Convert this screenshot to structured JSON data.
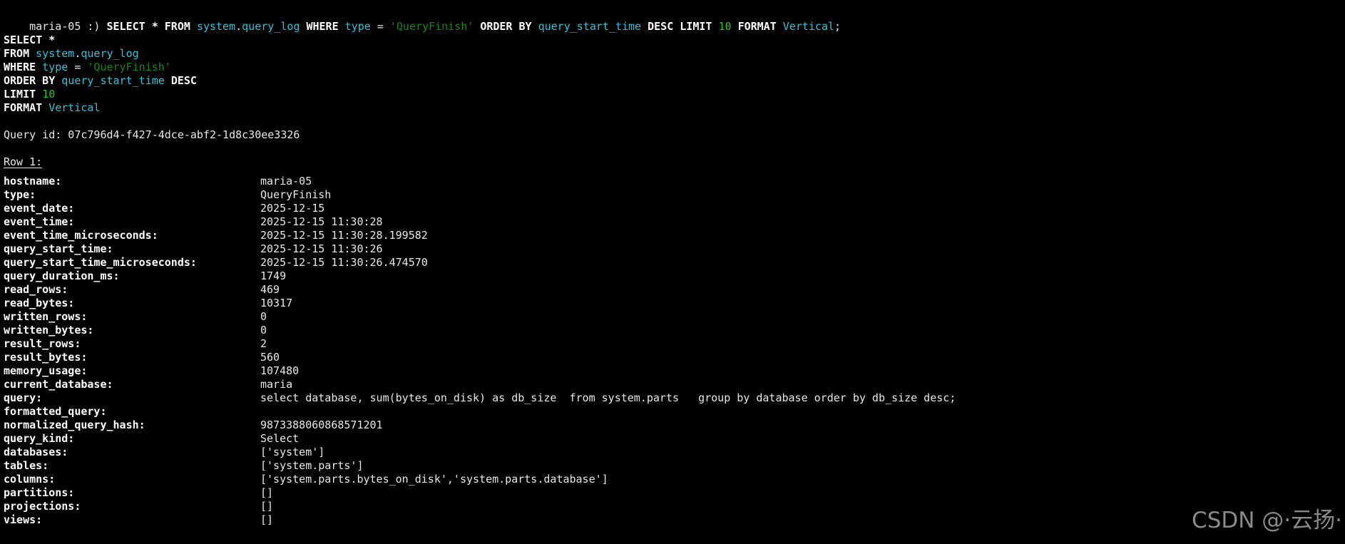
{
  "prompt": {
    "host": "maria-05",
    "symbol": ":)"
  },
  "command_tokens": [
    {
      "t": "SELECT",
      "c": "kw"
    },
    {
      "t": " * ",
      "c": "kw"
    },
    {
      "t": "FROM",
      "c": "kw"
    },
    {
      "t": " ",
      "c": "plain"
    },
    {
      "t": "system",
      "c": "id"
    },
    {
      "t": ".",
      "c": "plain"
    },
    {
      "t": "query_log",
      "c": "id"
    },
    {
      "t": " ",
      "c": "plain"
    },
    {
      "t": "WHERE",
      "c": "kw"
    },
    {
      "t": " ",
      "c": "plain"
    },
    {
      "t": "type",
      "c": "id"
    },
    {
      "t": " = ",
      "c": "plain"
    },
    {
      "t": "'QueryFinish'",
      "c": "str"
    },
    {
      "t": " ",
      "c": "plain"
    },
    {
      "t": "ORDER BY",
      "c": "kw"
    },
    {
      "t": " ",
      "c": "plain"
    },
    {
      "t": "query_start_time",
      "c": "id"
    },
    {
      "t": " ",
      "c": "plain"
    },
    {
      "t": "DESC",
      "c": "kw"
    },
    {
      "t": " ",
      "c": "plain"
    },
    {
      "t": "LIMIT",
      "c": "kw"
    },
    {
      "t": " ",
      "c": "plain"
    },
    {
      "t": "10",
      "c": "num"
    },
    {
      "t": " ",
      "c": "plain"
    },
    {
      "t": "FORMAT",
      "c": "kw"
    },
    {
      "t": " ",
      "c": "plain"
    },
    {
      "t": "Vertical",
      "c": "id"
    },
    {
      "t": ";",
      "c": "plain"
    }
  ],
  "formatted_lines": [
    [
      {
        "t": "SELECT *",
        "c": "kw"
      }
    ],
    [
      {
        "t": "FROM",
        "c": "kw"
      },
      {
        "t": " ",
        "c": "plain"
      },
      {
        "t": "system",
        "c": "id"
      },
      {
        "t": ".",
        "c": "plain"
      },
      {
        "t": "query_log",
        "c": "id"
      }
    ],
    [
      {
        "t": "WHERE",
        "c": "kw"
      },
      {
        "t": " ",
        "c": "plain"
      },
      {
        "t": "type",
        "c": "id"
      },
      {
        "t": " = ",
        "c": "plain"
      },
      {
        "t": "'QueryFinish'",
        "c": "str"
      }
    ],
    [
      {
        "t": "ORDER BY",
        "c": "kw"
      },
      {
        "t": " ",
        "c": "plain"
      },
      {
        "t": "query_start_time",
        "c": "id"
      },
      {
        "t": " ",
        "c": "plain"
      },
      {
        "t": "DESC",
        "c": "kw"
      }
    ],
    [
      {
        "t": "LIMIT",
        "c": "kw"
      },
      {
        "t": " ",
        "c": "plain"
      },
      {
        "t": "10",
        "c": "num"
      }
    ],
    [
      {
        "t": "FORMAT",
        "c": "kw"
      },
      {
        "t": " ",
        "c": "plain"
      },
      {
        "t": "Vertical",
        "c": "id"
      }
    ]
  ],
  "query_id_line": "Query id: 07c796d4-f427-4dce-abf2-1d8c30ee3326",
  "row_header": "Row 1:",
  "fields": [
    {
      "name": "hostname:",
      "value": "maria-05"
    },
    {
      "name": "type:",
      "value": "QueryFinish"
    },
    {
      "name": "event_date:",
      "value": "2025-12-15"
    },
    {
      "name": "event_time:",
      "value": "2025-12-15 11:30:28"
    },
    {
      "name": "event_time_microseconds:",
      "value": "2025-12-15 11:30:28.199582"
    },
    {
      "name": "query_start_time:",
      "value": "2025-12-15 11:30:26"
    },
    {
      "name": "query_start_time_microseconds:",
      "value": "2025-12-15 11:30:26.474570"
    },
    {
      "name": "query_duration_ms:",
      "value": "1749"
    },
    {
      "name": "read_rows:",
      "value": "469"
    },
    {
      "name": "read_bytes:",
      "value": "10317"
    },
    {
      "name": "written_rows:",
      "value": "0"
    },
    {
      "name": "written_bytes:",
      "value": "0"
    },
    {
      "name": "result_rows:",
      "value": "2"
    },
    {
      "name": "result_bytes:",
      "value": "560"
    },
    {
      "name": "memory_usage:",
      "value": "107480"
    },
    {
      "name": "current_database:",
      "value": "maria"
    },
    {
      "name": "query:",
      "value": "select database, sum(bytes_on_disk) as db_size  from system.parts   group by database order by db_size desc;"
    },
    {
      "name": "formatted_query:",
      "value": ""
    },
    {
      "name": "normalized_query_hash:",
      "value": "9873388060868571201"
    },
    {
      "name": "query_kind:",
      "value": "Select"
    },
    {
      "name": "databases:",
      "value": "['system']"
    },
    {
      "name": "tables:",
      "value": "['system.parts']"
    },
    {
      "name": "columns:",
      "value": "['system.parts.bytes_on_disk','system.parts.database']"
    },
    {
      "name": "partitions:",
      "value": "[]"
    },
    {
      "name": "projections:",
      "value": "[]"
    },
    {
      "name": "views:",
      "value": "[]"
    }
  ],
  "watermark": "CSDN @·云扬·",
  "colors": {
    "background": "#000000",
    "keyword": "#ffffff",
    "identifier": "#2ec4d6",
    "string": "#0f8a0f",
    "number": "#22c41e",
    "text": "#e8e8e8"
  }
}
